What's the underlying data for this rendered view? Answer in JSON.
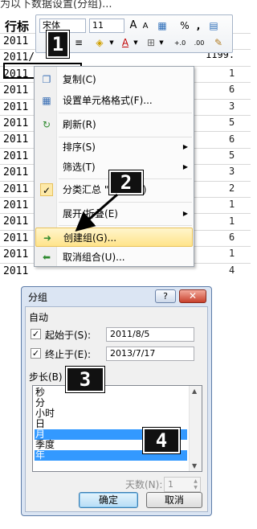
{
  "caption": "为以下数据设置(分组)...",
  "sheet": {
    "row_header_label": "行标",
    "row_values": [
      "2011",
      "2011/",
      "2011",
      "2011",
      "2011",
      "2011",
      "2011",
      "2011",
      "2011",
      "2011",
      "2011",
      "2011",
      "2011",
      "2011",
      "2011"
    ],
    "value_right": "1199.",
    "edge_digits": [
      "1",
      "6",
      "3",
      "5",
      "6",
      "5",
      "3",
      "2",
      "1",
      "1",
      "6",
      "1",
      "4"
    ]
  },
  "toolbar": {
    "font_name": "宋体",
    "font_size": "11",
    "grow_font": "A",
    "shrink_font": "A",
    "format_icon": "format-painter-icon",
    "percent": "%",
    "comma": ",",
    "decimal_increase": "+.0",
    "decimal_decrease": ".00"
  },
  "context_menu": {
    "items": [
      {
        "label": "复制(C)",
        "icon": "copy-icon"
      },
      {
        "label": "设置单元格格式(F)...",
        "icon": "format-cells-icon"
      },
      {
        "label": "刷新(R)",
        "icon": "refresh-icon"
      },
      {
        "label": "排序(S)",
        "submenu": true
      },
      {
        "label": "筛选(T)",
        "submenu": true
      },
      {
        "label": "分类汇总 \"日期\"(B)",
        "checked": true
      },
      {
        "label": "展开/折叠(E)",
        "submenu": true
      },
      {
        "label": "创建组(G)...",
        "icon": "group-arrow-icon",
        "highlighted": true
      },
      {
        "label": "取消组合(U)...",
        "icon": "ungroup-arrow-icon"
      }
    ],
    "check_glyph": "✓"
  },
  "callouts": [
    "1",
    "2",
    "3",
    "4"
  ],
  "dialog": {
    "title": "分组",
    "help": "?",
    "close": "✕",
    "auto_label": "自动",
    "start_label": "起始于(S):",
    "start_value": "2011/8/5",
    "end_label": "终止于(E):",
    "end_value": "2013/7/17",
    "step_label": "步长(B)",
    "step_options": [
      {
        "label": "秒",
        "selected": false
      },
      {
        "label": "分",
        "selected": false
      },
      {
        "label": "小时",
        "selected": false
      },
      {
        "label": "日",
        "selected": false
      },
      {
        "label": "月",
        "selected": true
      },
      {
        "label": "季度",
        "selected": false
      },
      {
        "label": "年",
        "selected": true
      }
    ],
    "days_label": "天数(N):",
    "days_value": "1",
    "ok_label": "确定",
    "cancel_label": "取消",
    "colors": {
      "selection": "#3399ff",
      "frame": "#dbe5f3",
      "close": "#c8402c"
    }
  }
}
